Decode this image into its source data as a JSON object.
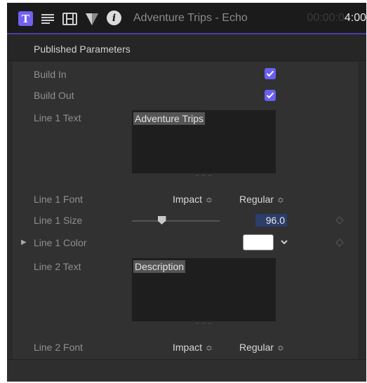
{
  "header": {
    "title": "Adventure Trips - Echo",
    "timecode_dim": "00:00:0",
    "timecode_bright": "4:00",
    "icons": [
      "text-inspector-icon",
      "lines-icon",
      "film-icon",
      "filter-icon",
      "info-icon"
    ],
    "text_icon_glyph": "T",
    "info_icon_glyph": "i",
    "accent_color": "#7262f3"
  },
  "section": {
    "title": "Published Parameters"
  },
  "params": {
    "build_in": {
      "label": "Build In",
      "checked": true
    },
    "build_out": {
      "label": "Build Out",
      "checked": true
    },
    "line1_text": {
      "label": "Line 1 Text",
      "value": "Adventure Trips"
    },
    "line1_font": {
      "label": "Line 1 Font",
      "family": "Impact",
      "style": "Regular"
    },
    "line1_size": {
      "label": "Line 1 Size",
      "value": "96.0",
      "slider_fraction": 0.34
    },
    "line1_color": {
      "label": "Line 1 Color",
      "swatch": "#ffffff"
    },
    "line2_text": {
      "label": "Line 2 Text",
      "value": "Description"
    },
    "line2_font": {
      "label": "Line 2 Font",
      "family": "Impact",
      "style": "Regular"
    }
  },
  "glyphs": {
    "updown": "⌃⌄",
    "chevron_down": "⌄",
    "disclosure": "▶"
  }
}
